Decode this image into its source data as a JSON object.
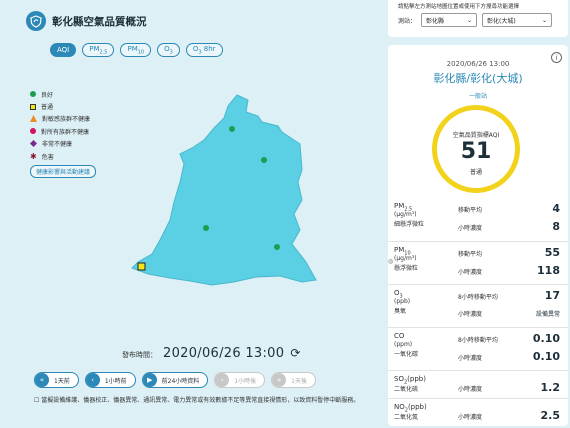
{
  "header": {
    "title": "彰化縣空氣品質概況"
  },
  "tabs": [
    {
      "label": "AQI",
      "active": true
    },
    {
      "label": "PM2.5"
    },
    {
      "label": "PM10"
    },
    {
      "label": "O3"
    },
    {
      "label": "O3 8hr"
    }
  ],
  "legend": {
    "items": [
      {
        "label": "良好",
        "color": "#1a9e52",
        "shape": "circle"
      },
      {
        "label": "普通",
        "color": "#f2e61b",
        "shape": "square"
      },
      {
        "label": "對敏感族群不健康",
        "color": "#ef8a26",
        "shape": "triangle"
      },
      {
        "label": "對所有族群不健康",
        "color": "#d6145f",
        "shape": "circle"
      },
      {
        "label": "非常不健康",
        "color": "#7b2a8f",
        "shape": "diamond"
      },
      {
        "label": "危害",
        "color": "#8b1a2e",
        "shape": "star"
      }
    ],
    "health_link": "健康影響與活動建議"
  },
  "map": {
    "fill": "#5bcfe4"
  },
  "publish": {
    "label": "發布時間：",
    "value": "2020/06/26 13:00"
  },
  "controls": [
    {
      "label": "1天前",
      "icon": "«",
      "disabled": false
    },
    {
      "label": "1小時前",
      "icon": "‹",
      "disabled": false
    },
    {
      "label": "前24小時資料",
      "icon": "▶",
      "disabled": false
    },
    {
      "label": "1小時後",
      "icon": "›",
      "disabled": true
    },
    {
      "label": "1天後",
      "icon": "»",
      "disabled": true
    }
  ],
  "note": "☐ 當擬設備維護、儀器校正、儀器異常、通訊異常、電力異常或有效數據不足等異常直接視情形，以致資料暫停中斷服務。",
  "picker": {
    "note": "請點擊左方測站地圖位置或使用下方搜尋功能選擇",
    "label": "測站：",
    "county": "彰化縣",
    "station": "彰化(大城)"
  },
  "station": {
    "time": "2020/06/26 13:00",
    "name": "彰化縣/彰化(大城)",
    "type": "一般站",
    "aqi_label": "空氣品質指標AQI",
    "aqi_value": "51",
    "aqi_status": "普通",
    "ring_color": "#f2d21b"
  },
  "pollutants": [
    {
      "name": "PM",
      "sub": "2.5",
      "unit": "(μg/m³)",
      "cn": "細懸浮微粒",
      "rows": [
        {
          "label": "移動平均",
          "value": "4"
        },
        {
          "label": "小時濃度",
          "value": "8"
        }
      ]
    },
    {
      "name": "PM",
      "sub": "10",
      "unit": "(μg/m³)",
      "cn": "懸浮微粒",
      "marker": "◎",
      "rows": [
        {
          "label": "移動平均",
          "value": "55"
        },
        {
          "label": "小時濃度",
          "value": "118"
        }
      ]
    },
    {
      "name": "O",
      "sub": "3",
      "unit": "(ppb)",
      "cn": "臭氧",
      "rows": [
        {
          "label": "8小時移動平均",
          "value": "17"
        },
        {
          "label": "小時濃度",
          "value": "設備異常",
          "small": true
        }
      ]
    },
    {
      "name": "CO",
      "sub": "",
      "unit": "(ppm)",
      "cn": "一氧化碳",
      "rows": [
        {
          "label": "8小時移動平均",
          "value": "0.10"
        },
        {
          "label": "小時濃度",
          "value": "0.10"
        }
      ]
    },
    {
      "name": "SO",
      "sub": "2",
      "unit": "(ppb)",
      "cn": "二氧化硫",
      "rows": [
        {
          "label": "小時濃度",
          "value": "1.2"
        }
      ]
    },
    {
      "name": "NO",
      "sub": "2",
      "unit": "(ppb)",
      "cn": "二氧化氮",
      "rows": [
        {
          "label": "小時濃度",
          "value": "2.5"
        }
      ]
    }
  ]
}
